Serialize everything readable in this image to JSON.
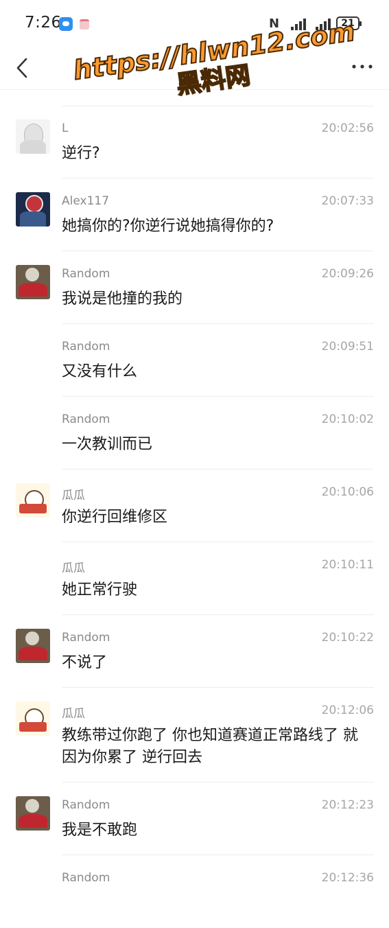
{
  "status_bar": {
    "time": "7:26",
    "battery": "21"
  },
  "nav": {
    "more_label": "..."
  },
  "watermark": {
    "line1": "https://hlwn12.com",
    "line2": "黑料网"
  },
  "messages": [
    {
      "sender": "L",
      "time": "20:02:56",
      "text": "逆行?",
      "avatar": "l"
    },
    {
      "sender": "Alex117",
      "time": "20:07:33",
      "text": "她搞你的?你逆行说她搞得你的?",
      "avatar": "alex"
    },
    {
      "sender": "Random",
      "time": "20:09:26",
      "text": "我说是他撞的我的",
      "avatar": "random"
    },
    {
      "sender": "Random",
      "time": "20:09:51",
      "text": "又没有什么",
      "avatar": ""
    },
    {
      "sender": "Random",
      "time": "20:10:02",
      "text": "一次教训而已",
      "avatar": ""
    },
    {
      "sender": "瓜瓜",
      "time": "20:10:06",
      "text": "你逆行回维修区",
      "avatar": "gua"
    },
    {
      "sender": "瓜瓜",
      "time": "20:10:11",
      "text": "她正常行驶",
      "avatar": ""
    },
    {
      "sender": "Random",
      "time": "20:10:22",
      "text": "不说了",
      "avatar": "random"
    },
    {
      "sender": "瓜瓜",
      "time": "20:12:06",
      "text": "教练带过你跑了 你也知道赛道正常路线了 就因为你累了 逆行回去",
      "avatar": "gua"
    },
    {
      "sender": "Random",
      "time": "20:12:23",
      "text": "我是不敢跑",
      "avatar": "random"
    },
    {
      "sender": "Random",
      "time": "20:12:36",
      "text": "",
      "avatar": ""
    }
  ]
}
